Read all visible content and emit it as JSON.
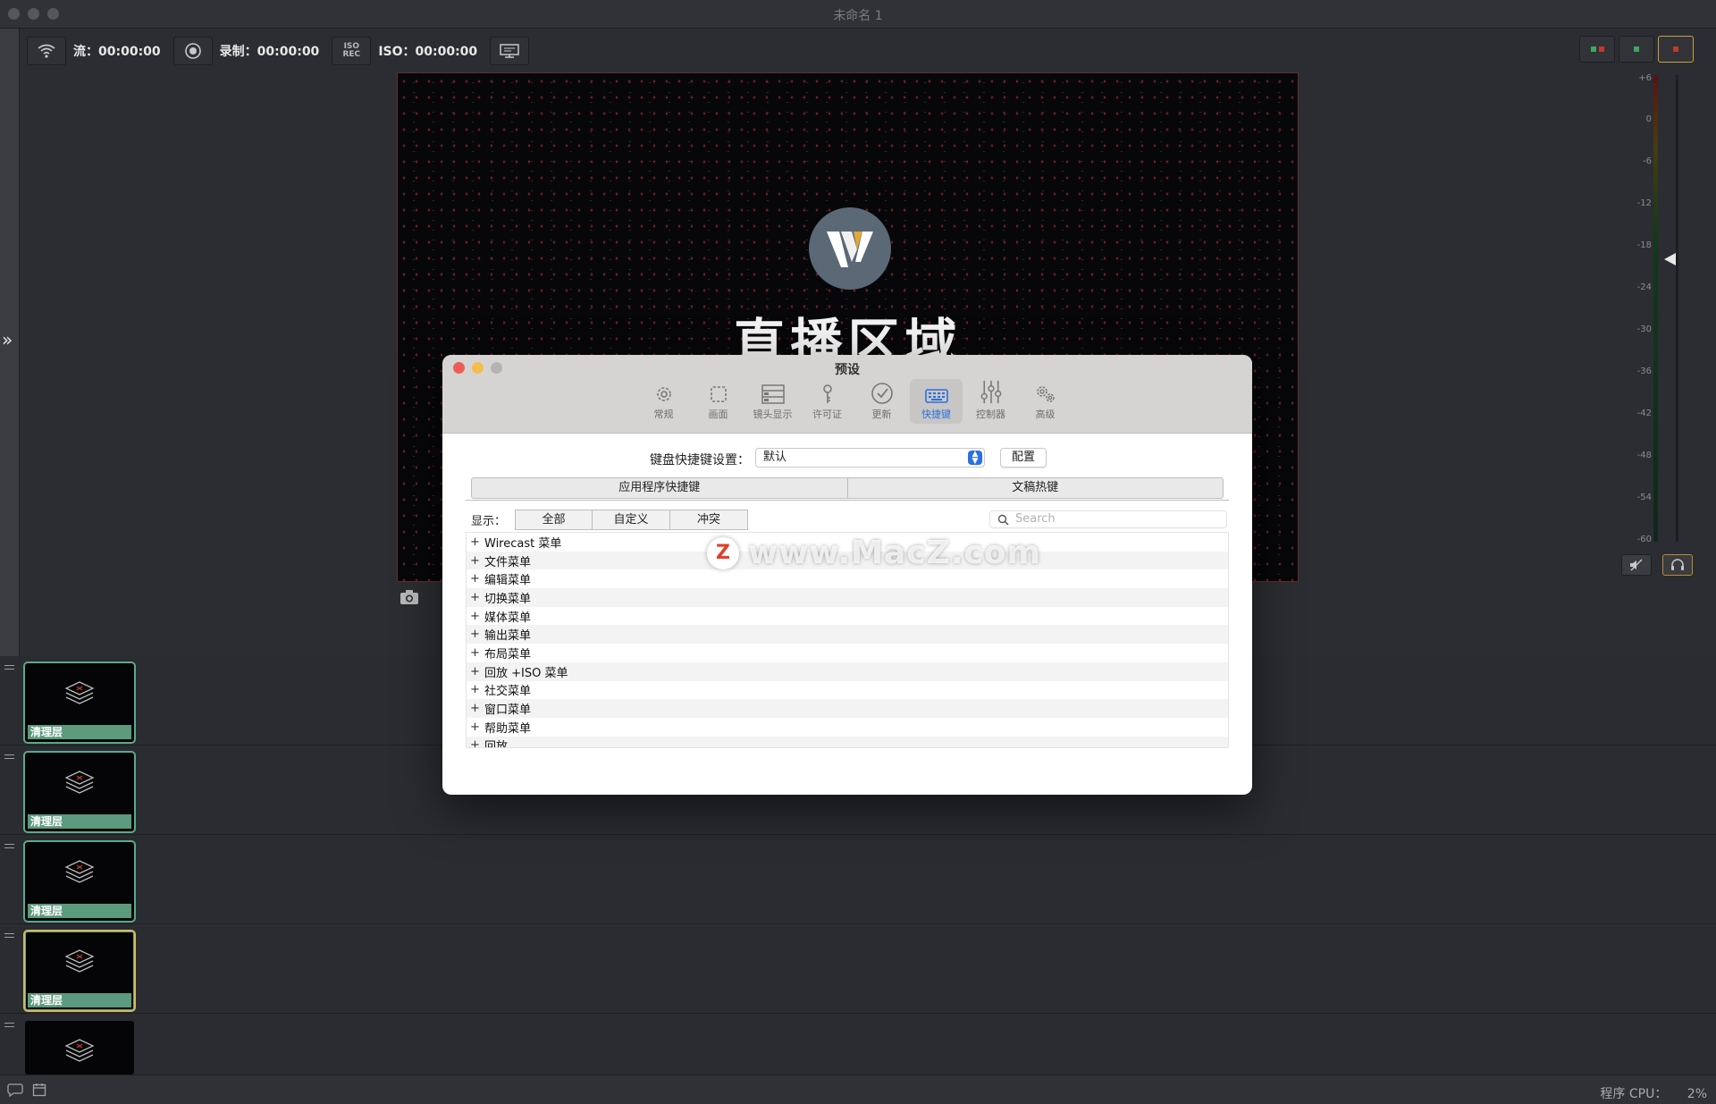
{
  "window": {
    "title": "未命名 1"
  },
  "status": {
    "stream_label": "流：00:00:00",
    "record_label": "录制：00:00:00",
    "iso_label": "ISO：00:00:00",
    "iso_icon_text": "ISO REC"
  },
  "preview": {
    "title": "直播区域"
  },
  "meter": {
    "ticks": [
      "+6",
      "0",
      "-6",
      "-12",
      "-18",
      "-24",
      "-30",
      "-36",
      "-42",
      "-48",
      "-54",
      "-60"
    ]
  },
  "layers": {
    "rows": [
      {
        "label": "清理层"
      },
      {
        "label": "清理层"
      },
      {
        "label": "清理层"
      },
      {
        "label": "清理层"
      },
      {
        "label": ""
      }
    ]
  },
  "bottom": {
    "cpu_label": "程序 CPU：",
    "cpu_value": "2%"
  },
  "prefs": {
    "title": "预设",
    "tabs": [
      {
        "label": "常规",
        "icon": "gear-icon"
      },
      {
        "label": "画面",
        "icon": "frame-icon"
      },
      {
        "label": "镜头显示",
        "icon": "shots-icon"
      },
      {
        "label": "许可证",
        "icon": "key-icon"
      },
      {
        "label": "更新",
        "icon": "check-circle-icon"
      },
      {
        "label": "快捷键",
        "icon": "keyboard-icon"
      },
      {
        "label": "控制器",
        "icon": "sliders-icon"
      },
      {
        "label": "高级",
        "icon": "gears-icon"
      }
    ],
    "shortcut_setting_label": "键盘快捷键设置：",
    "shortcut_setting_value": "默认",
    "configure_label": "配置",
    "segments": [
      "应用程序快捷键",
      "文稿热键"
    ],
    "show_label": "显示：",
    "filters": [
      "全部",
      "自定义",
      "冲突"
    ],
    "search_placeholder": "Search",
    "menu_items": [
      "Wirecast 菜单",
      "文件菜单",
      "编辑菜单",
      "切换菜单",
      "媒体菜单",
      "输出菜单",
      "布局菜单",
      "回放 +ISO 菜单",
      "社交菜单",
      "窗口菜单",
      "帮助菜单",
      "回放"
    ]
  },
  "watermark": {
    "badge": "Z",
    "text": "www.MacZ.com"
  },
  "colors": {
    "accent": "#2c6fe0",
    "layer_border": "#5ba98a",
    "layer_selected": "#d7b85a",
    "close": "#ee5d55",
    "minimize": "#f4be4f"
  }
}
